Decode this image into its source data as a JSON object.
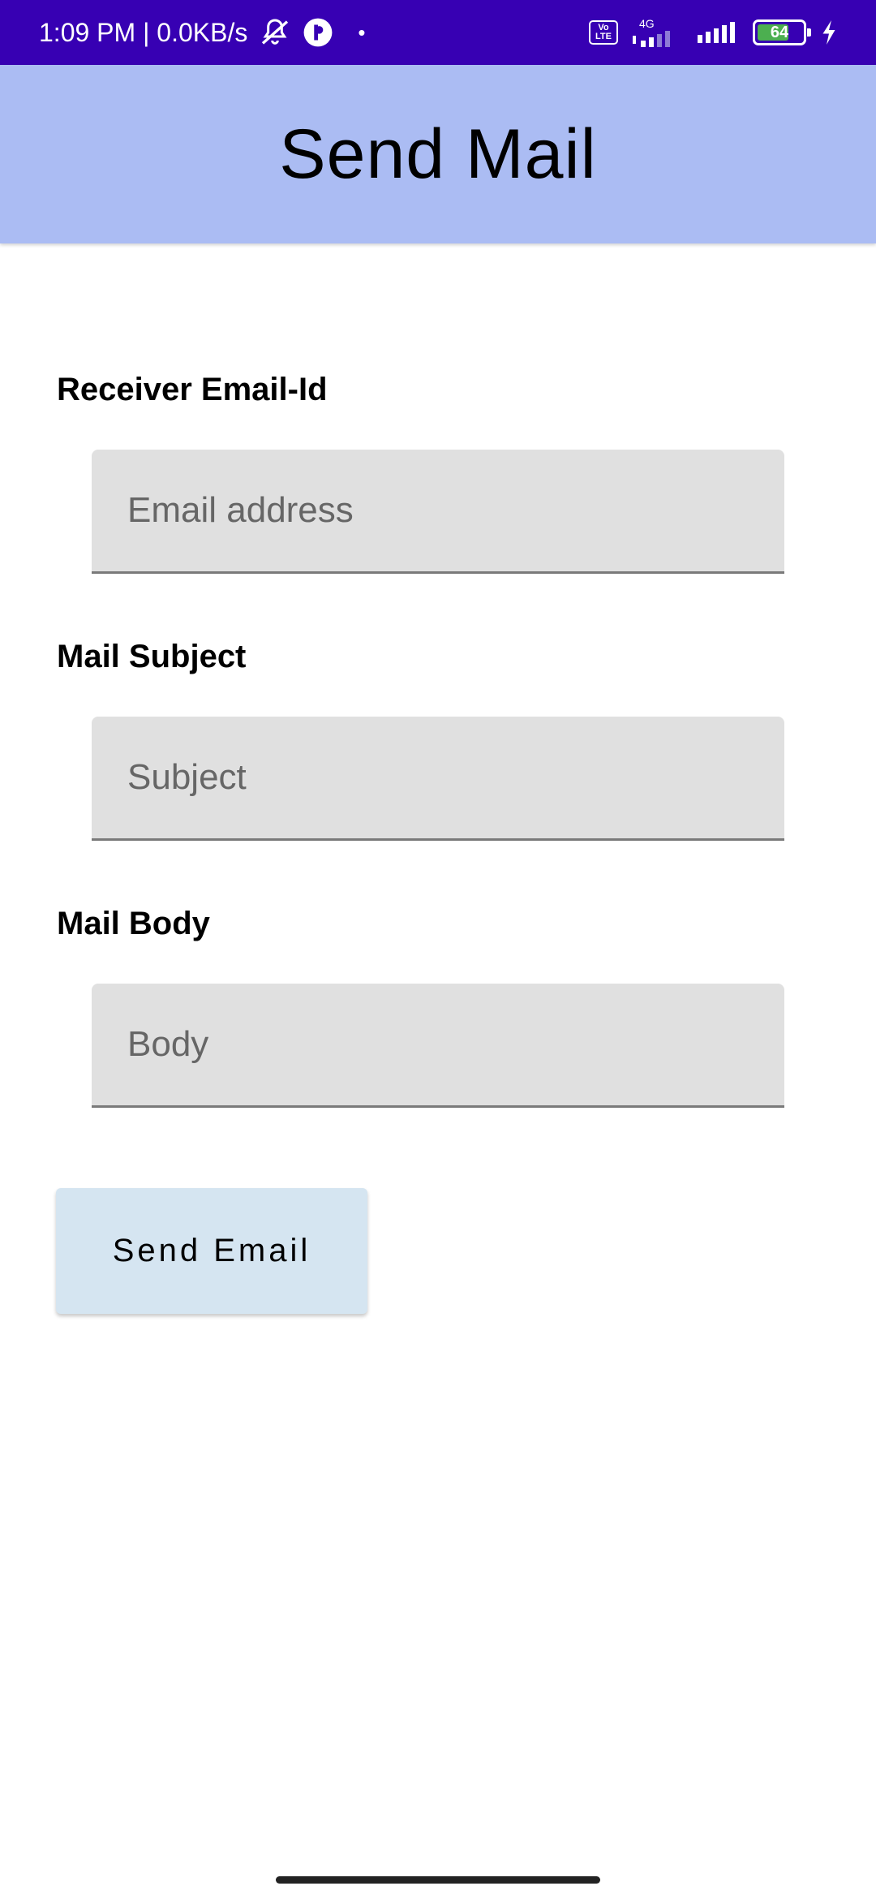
{
  "status_bar": {
    "time_speed": "1:09 PM | 0.0KB/s",
    "volte_top": "Vo",
    "volte_bottom": "LTE",
    "network": "4G",
    "battery": "64"
  },
  "app_bar": {
    "title": "Send Mail"
  },
  "form": {
    "receiver_label": "Receiver Email-Id",
    "email_placeholder": "Email address",
    "email_value": "",
    "subject_label": "Mail Subject",
    "subject_placeholder": "Subject",
    "subject_value": "",
    "body_label": "Mail Body",
    "body_placeholder": "Body",
    "body_value": ""
  },
  "send_button": {
    "label": "Send Email"
  },
  "colors": {
    "status_bar": "#3700b3",
    "app_bar": "#abbcf3",
    "field_bg": "#e0e0e0",
    "button_bg": "#d5e5f1"
  }
}
